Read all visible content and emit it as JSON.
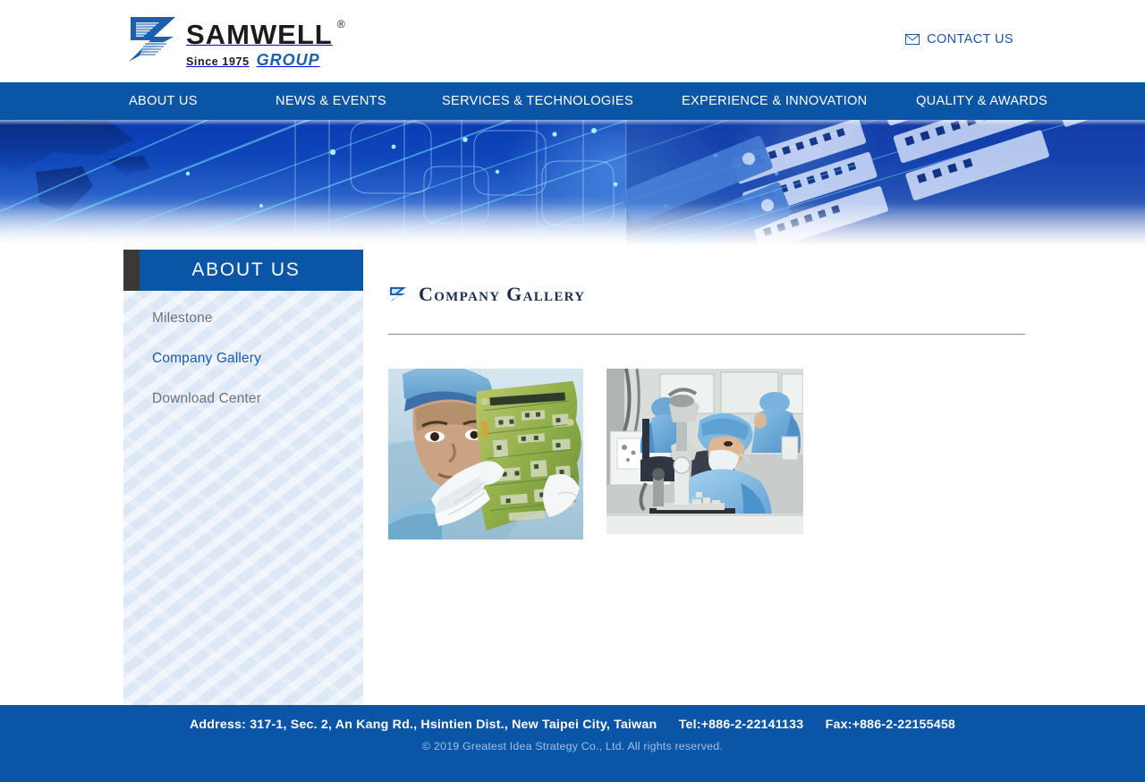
{
  "header": {
    "logo": {
      "name": "SAMWELL",
      "registered": "®",
      "since": "Since 1975",
      "group": "GROUP",
      "mark_icon": "samwell-z-mark"
    },
    "contact": {
      "label": "CONTACT US",
      "icon": "mail-icon",
      "color": "#1b57a5"
    }
  },
  "nav": {
    "background": "#0a55a6",
    "items": [
      {
        "label": "ABOUT US"
      },
      {
        "label": "NEWS & EVENTS"
      },
      {
        "label": "SERVICES & TECHNOLOGIES"
      },
      {
        "label": "EXPERIENCE & INNOVATION"
      },
      {
        "label": "QUALITY & AWARDS"
      }
    ]
  },
  "hero": {
    "alt": "Blue circuit board and technology banner graphic"
  },
  "sidebar": {
    "heading": "ABOUT US",
    "accent": "#0a55a6",
    "items": [
      {
        "label": "Milestone",
        "active": false
      },
      {
        "label": "Company Gallery",
        "active": true
      },
      {
        "label": "Download Center",
        "active": false
      }
    ]
  },
  "main": {
    "title": "Company Gallery",
    "title_icon": "samwell-z-mark",
    "gallery": [
      {
        "caption": "Technician in cleanroom attire inspecting a green printed circuit board"
      },
      {
        "caption": "Cleanroom workers performing microscope inspection at workbenches"
      }
    ]
  },
  "footer": {
    "address": "Address: 317-1, Sec. 2, An Kang Rd., Hsintien Dist., New Taipei City, Taiwan",
    "tel": "Tel:+886-2-22141133",
    "fax": "Fax:+886-2-22155458",
    "copyright": "© 2019 Greatest Idea Strategy Co., Ltd. All rights reserved.",
    "background": "#0a55a6"
  }
}
